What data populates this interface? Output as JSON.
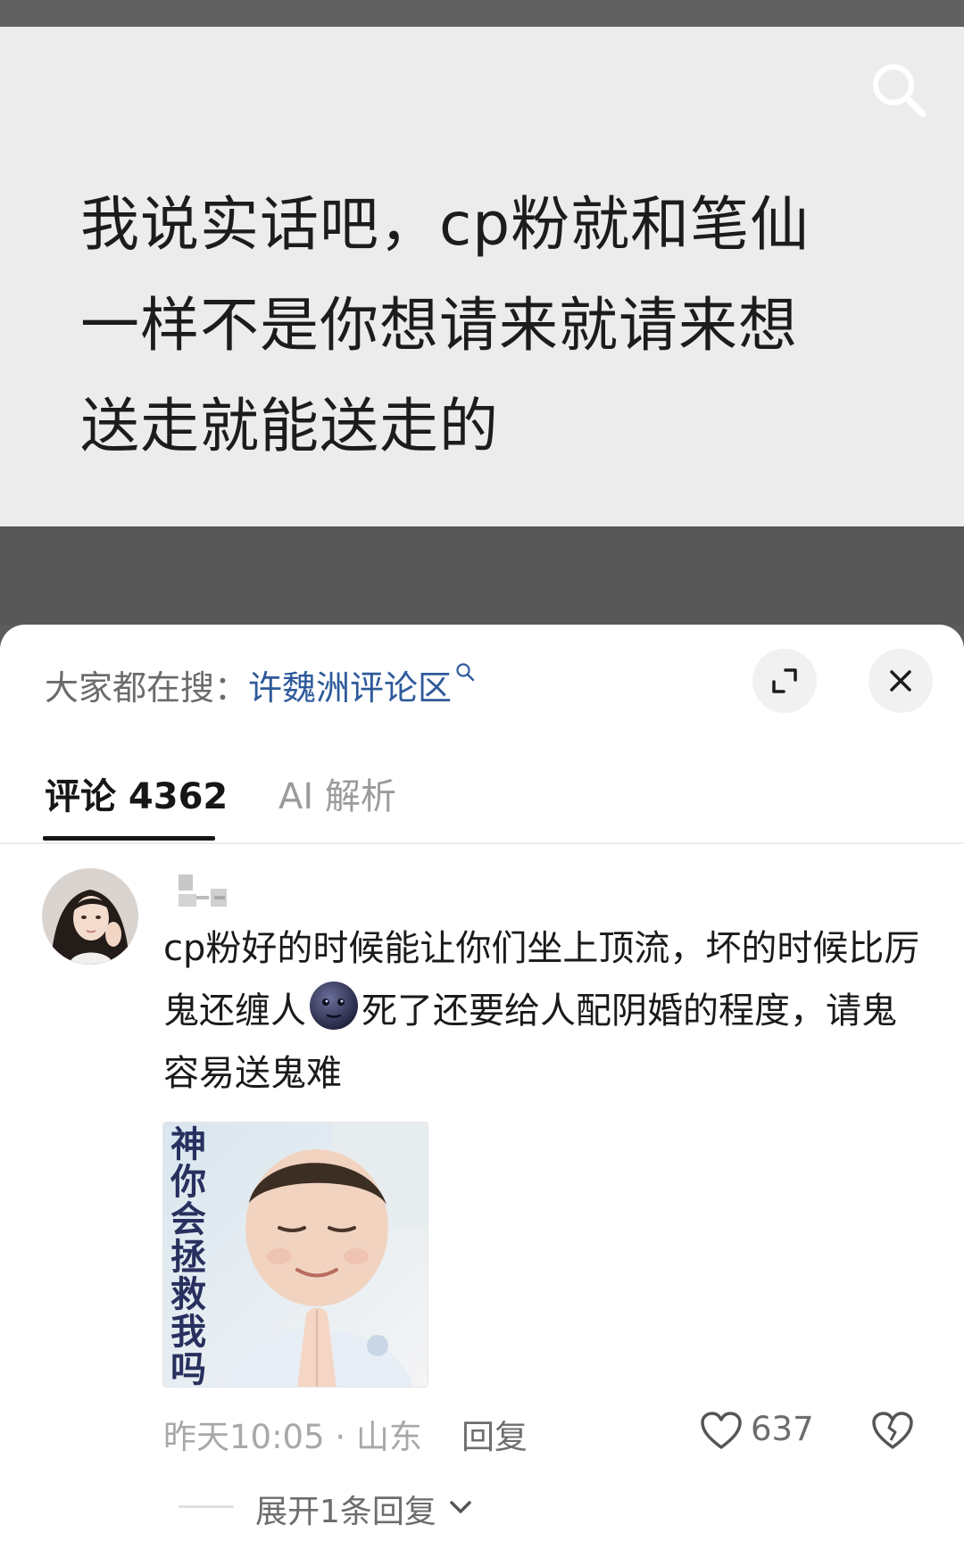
{
  "video": {
    "line1": "我说实话吧，cp粉就和笔仙",
    "line2": "一样不是你想请来就请来想",
    "line3": "送走就能送走的"
  },
  "sheet": {
    "hot_search_label": "大家都在搜：",
    "hot_search_term": "许魏洲评论区",
    "tabs": [
      {
        "label": "评论 4362",
        "active": true
      },
      {
        "label": "AI 解析",
        "active": false
      }
    ]
  },
  "comment": {
    "text_part1": "cp粉好的时候能让你们坐上顶流，坏的时候比厉鬼还缠人",
    "emoji": "moon-face-icon",
    "text_part2": "死了还要给人配阴婚的程度，请鬼容易送鬼难",
    "meme_caption": "神你会拯救我吗",
    "time_location": "昨天10:05 · 山东",
    "reply_label": "回复",
    "like_count": "637",
    "expand_label": "展开1条回复"
  },
  "colors": {
    "link_blue": "#2e5a9a",
    "text_dark": "#1a1a1a",
    "text_muted": "#a8a8a8"
  }
}
